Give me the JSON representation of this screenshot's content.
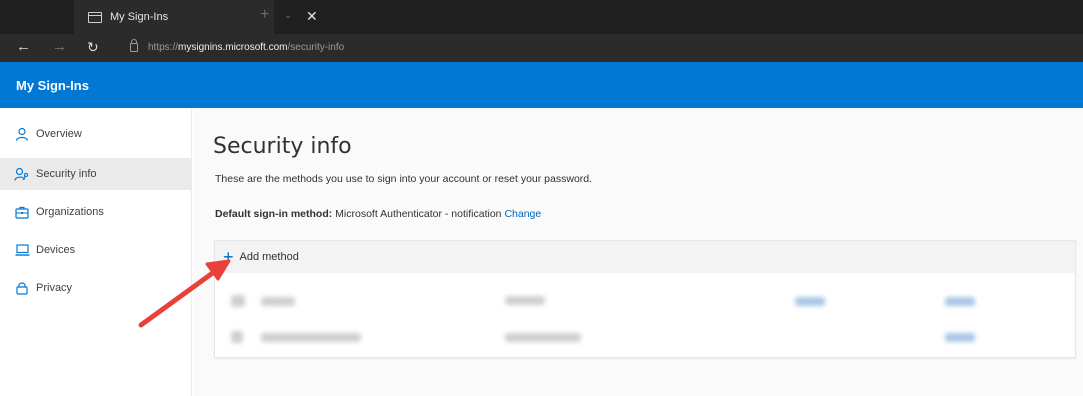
{
  "browser": {
    "tab_title": "My Sign-Ins",
    "tab_close": "✕",
    "tab_new": "+",
    "tab_more": "⌄",
    "url_prefix": "https://",
    "url_host": "mysignins.microsoft.com",
    "url_path": "/security-info",
    "nav": {
      "back": "←",
      "forward": "→",
      "reload": "↻"
    }
  },
  "app": {
    "title": "My Sign-Ins",
    "accent_color": "#0078d4"
  },
  "sidebar": {
    "items": [
      {
        "label": "Overview",
        "icon": "person-icon",
        "active": false
      },
      {
        "label": "Security info",
        "icon": "person-key-icon",
        "active": true
      },
      {
        "label": "Organizations",
        "icon": "briefcase-icon",
        "active": false
      },
      {
        "label": "Devices",
        "icon": "laptop-icon",
        "active": false
      },
      {
        "label": "Privacy",
        "icon": "lock-icon",
        "active": false
      }
    ]
  },
  "main": {
    "title": "Security info",
    "description": "These are the methods you use to sign into your account or reset your password.",
    "default_method": {
      "label": "Default sign-in method:",
      "value": "Microsoft Authenticator - notification",
      "change_link": "Change"
    },
    "add_method_label": "Add method"
  },
  "annotation": {
    "arrow_color": "#e8413c"
  }
}
